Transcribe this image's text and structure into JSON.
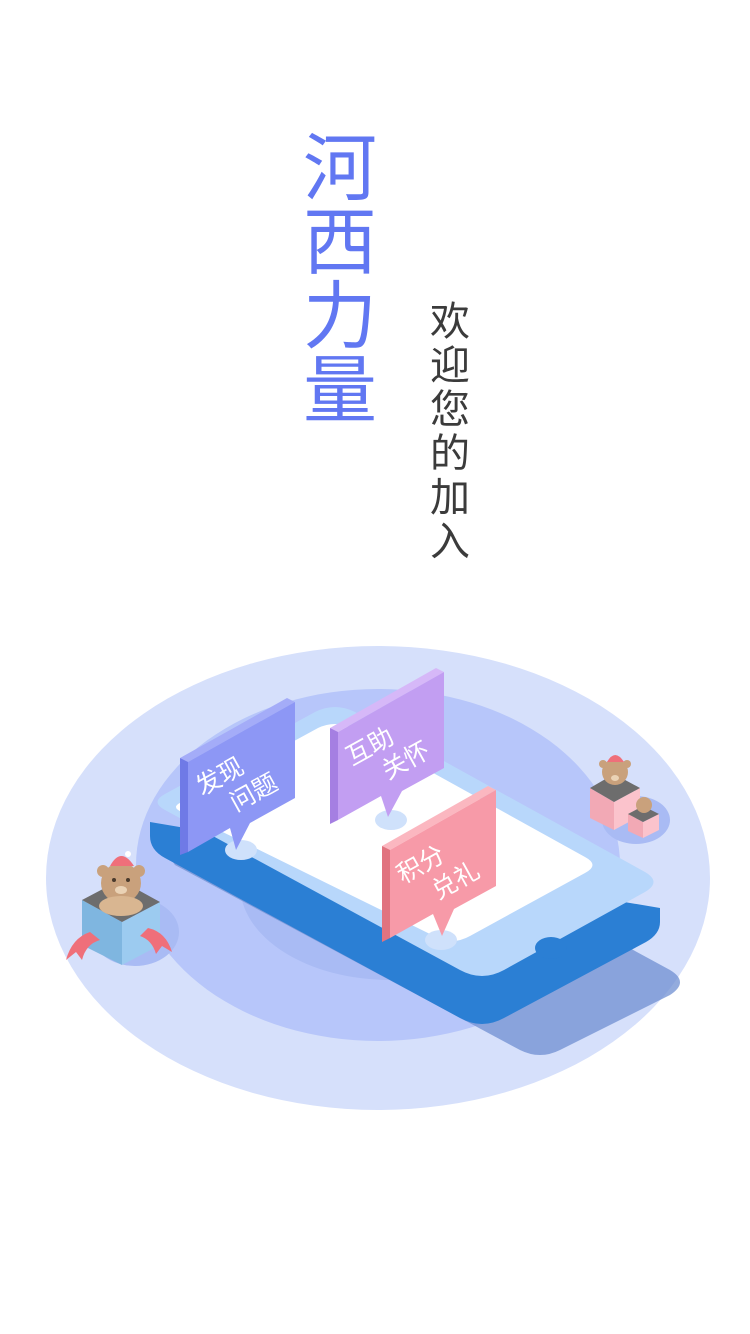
{
  "splash": {
    "title_chars": [
      "河",
      "西",
      "力",
      "量"
    ],
    "subtitle_chars": [
      "欢",
      "迎",
      "您",
      "的",
      "加",
      "入"
    ]
  },
  "illustration": {
    "bubbles": [
      {
        "line1": "发现",
        "line2": "问题",
        "color": "#8d97f5"
      },
      {
        "line1": "互助",
        "line2": "关怀",
        "color": "#c29ef2"
      },
      {
        "line1": "积分",
        "line2": "兑礼",
        "color": "#f79aa8"
      }
    ],
    "colors": {
      "accent": "#6177f2",
      "phone": "#2b7fd4",
      "ellipse": "#d6e0fb"
    }
  }
}
